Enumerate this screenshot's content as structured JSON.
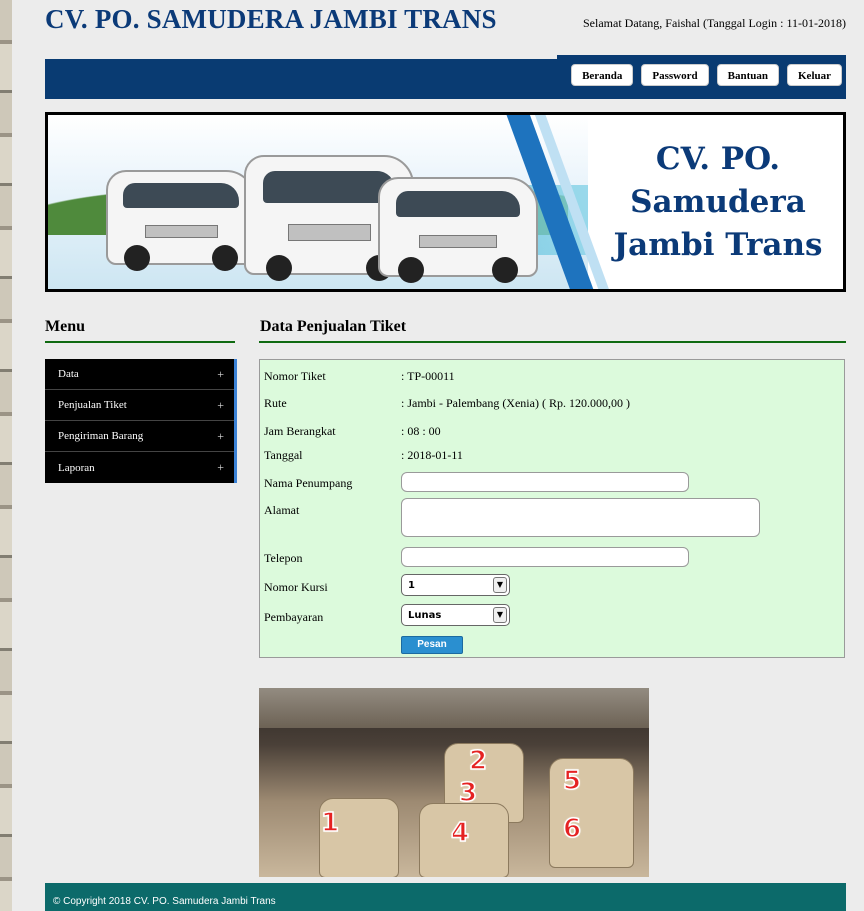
{
  "header": {
    "site_title": "CV. PO. SAMUDERA JAMBI TRANS",
    "welcome": "Selamat Datang, Faishal (Tanggal Login : 11-01-2018)"
  },
  "nav": {
    "items": [
      "Beranda",
      "Password",
      "Bantuan",
      "Keluar"
    ]
  },
  "banner": {
    "line1": "CV. PO.",
    "line2": "Samudera",
    "line3": "Jambi Trans"
  },
  "menu": {
    "heading": "Menu",
    "items": [
      {
        "label": "Data",
        "icon": "+"
      },
      {
        "label": "Penjualan Tiket",
        "icon": "+"
      },
      {
        "label": "Pengiriman Barang",
        "icon": "+"
      },
      {
        "label": "Laporan",
        "icon": "+"
      }
    ]
  },
  "content": {
    "heading": "Data Penjualan Tiket",
    "fields": {
      "nomor_tiket": {
        "label": "Nomor Tiket",
        "value": ": TP-00011"
      },
      "rute": {
        "label": "Rute",
        "value": ": Jambi - Palembang (Xenia) ( Rp. 120.000,00 )"
      },
      "jam": {
        "label": "Jam Berangkat",
        "value": ": 08 : 00"
      },
      "tanggal": {
        "label": "Tanggal",
        "value": ": 2018-01-11"
      },
      "nama": {
        "label": "Nama Penumpang",
        "value": ""
      },
      "alamat": {
        "label": "Alamat",
        "value": ""
      },
      "telepon": {
        "label": "Telepon",
        "value": ""
      },
      "kursi": {
        "label": "Nomor Kursi",
        "selected": "1"
      },
      "pembayaran": {
        "label": "Pembayaran",
        "selected": "Lunas"
      }
    },
    "submit_label": "Pesan"
  },
  "seat_map": {
    "numbers": [
      "1",
      "2",
      "3",
      "4",
      "5",
      "6"
    ]
  },
  "footer": {
    "text": "© Copyright 2018 CV. PO. Samudera Jambi Trans"
  }
}
